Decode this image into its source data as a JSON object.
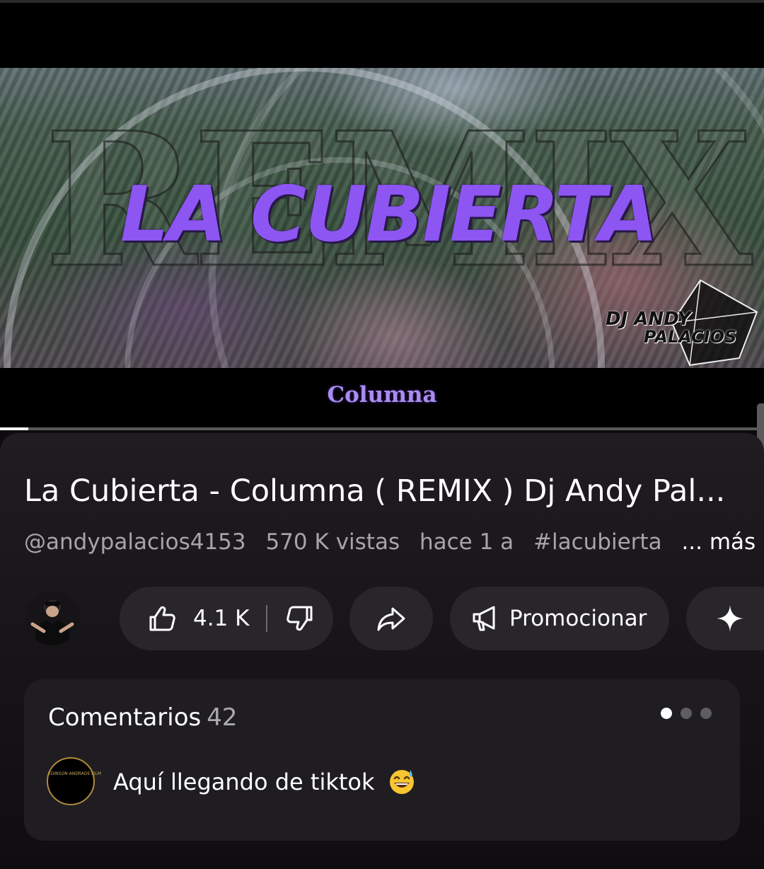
{
  "video": {
    "art_title": "LA CUBIERTA",
    "art_background": "REMIX",
    "art_logo_line1": "DJ ANDY",
    "art_logo_line2": "PALACIOS",
    "subtitle": "Columna",
    "progress": 0.037
  },
  "details": {
    "title": "La Cubierta - Columna ( REMIX ) Dj Andy Pal...",
    "channel": "@andypalacios4153",
    "views": "570 K vistas",
    "age": "hace 1 a",
    "hashtag": "#lacubierta",
    "more": "... más"
  },
  "actions": {
    "like_count": "4.1 K",
    "like_icon": "thumbs-up-icon",
    "dislike_icon": "thumbs-down-icon",
    "share_icon": "share-icon",
    "promote_label": "Promocionar",
    "promote_icon": "megaphone-icon",
    "extra_icon": "sparkle-icon"
  },
  "comments": {
    "title": "Comentarios",
    "count": "42",
    "first_comment": "Aquí llegando de tiktok",
    "first_comment_emoji": "grinning-sweat-emoji",
    "avatar_logo_text": "EDINSON ANDRADE FILM",
    "pager_total": 3,
    "pager_active": 1
  },
  "colors": {
    "background": "#0d0b0e",
    "pill": "#29262b",
    "card": "#1f1d21",
    "accent_text": "#a98cf0",
    "meta_text": "#a6a6a6"
  }
}
